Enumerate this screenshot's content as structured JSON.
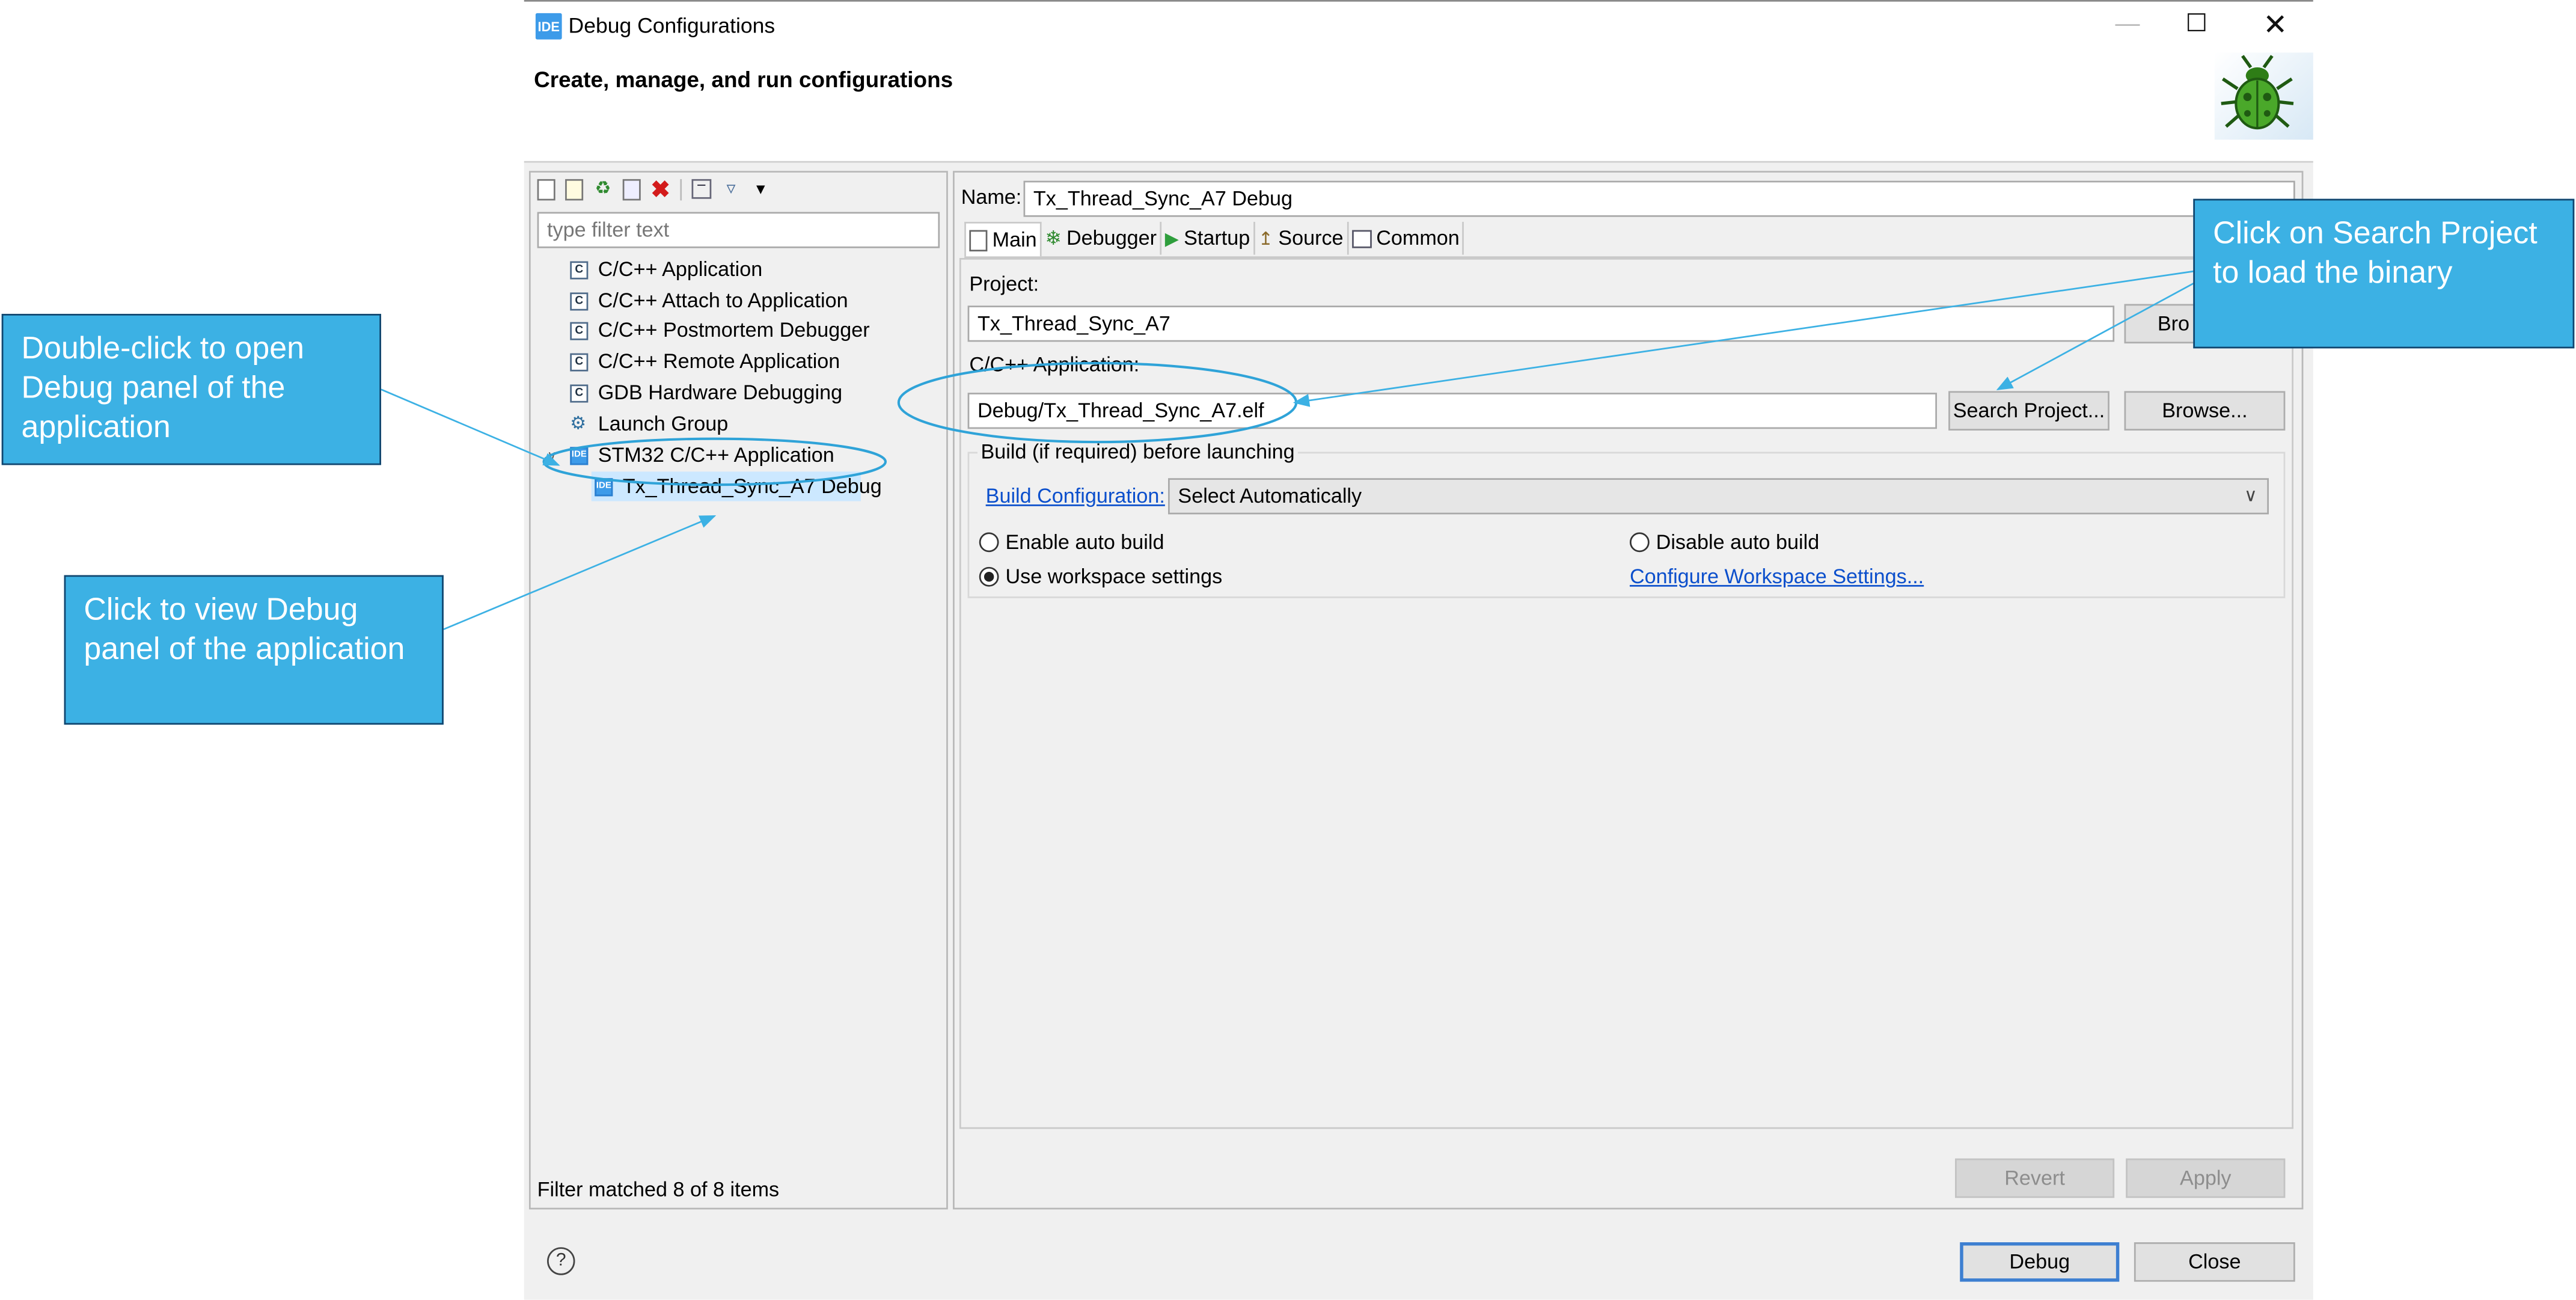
{
  "window": {
    "title": "Debug Configurations",
    "icon_text": "IDE",
    "subtitle": "Create, manage, and run configurations",
    "banner_icon": "bug-icon"
  },
  "left_panel": {
    "filter_placeholder": "type filter text",
    "toolbar_icons": [
      "new-config-icon",
      "new-prototype-icon",
      "export-icon",
      "duplicate-icon",
      "delete-icon",
      "collapse-all-icon",
      "filter-icon",
      "view-menu-icon"
    ],
    "tree": [
      {
        "label": "C/C++ Application",
        "icon": "c-app-icon"
      },
      {
        "label": "C/C++ Attach to Application",
        "icon": "c-app-icon"
      },
      {
        "label": "C/C++ Postmortem Debugger",
        "icon": "c-app-icon"
      },
      {
        "label": "C/C++ Remote Application",
        "icon": "c-app-icon"
      },
      {
        "label": "GDB Hardware Debugging",
        "icon": "c-app-icon"
      },
      {
        "label": "Launch Group",
        "icon": "launch-group-icon"
      },
      {
        "label": "STM32 C/C++ Application",
        "icon": "stm32-ide-icon",
        "expanded": true
      },
      {
        "label": "Tx_Thread_Sync_A7 Debug",
        "icon": "stm32-ide-icon",
        "selected": true
      }
    ],
    "status": "Filter matched 8 of 8 items"
  },
  "right_panel": {
    "name_label": "Name:",
    "name_value": "Tx_Thread_Sync_A7 Debug",
    "tabs": [
      {
        "label": "Main",
        "icon": "main-tab-icon",
        "active": true
      },
      {
        "label": "Debugger",
        "icon": "debugger-tab-icon"
      },
      {
        "label": "Startup",
        "icon": "startup-tab-icon"
      },
      {
        "label": "Source",
        "icon": "source-tab-icon"
      },
      {
        "label": "Common",
        "icon": "common-tab-icon"
      }
    ],
    "project_label": "Project:",
    "project_value": "Tx_Thread_Sync_A7",
    "project_browse": "Bro",
    "app_label": "C/C++ Application:",
    "app_value": "Debug/Tx_Thread_Sync_A7.elf",
    "search_project": "Search Project...",
    "browse": "Browse...",
    "build_group_label": "Build (if required) before launching",
    "build_config_link": "Build Configuration:",
    "build_config_value": "Select Automatically",
    "enable_auto": "Enable auto build",
    "disable_auto": "Disable auto build",
    "use_workspace": "Use workspace settings",
    "configure_workspace": "Configure Workspace Settings...",
    "revert": "Revert",
    "apply": "Apply"
  },
  "footer": {
    "help_glyph": "?",
    "debug": "Debug",
    "close": "Close"
  },
  "annotations": {
    "callout_search": "Click on Search Project to load the binary",
    "callout_double": "Double-click to open Debug panel of the application",
    "callout_view": "Click to view Debug panel of  the application",
    "accent_color": "#3cb1e4"
  }
}
